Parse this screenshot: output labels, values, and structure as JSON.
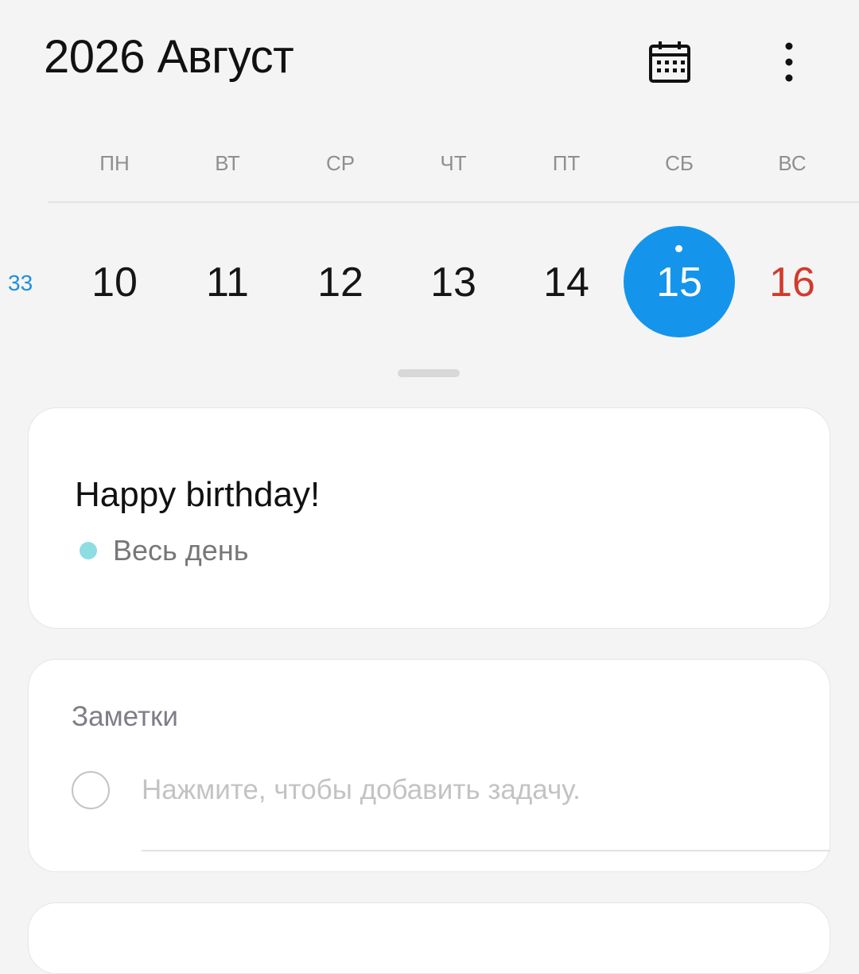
{
  "header": {
    "title": "2026 Август",
    "calendar_icon": "calendar-icon",
    "more_icon": "more-vertical-icon"
  },
  "week": {
    "number": "33",
    "weekdays": [
      "ПН",
      "ВТ",
      "СР",
      "ЧТ",
      "ПТ",
      "СБ",
      "ВС"
    ],
    "days": [
      "10",
      "11",
      "12",
      "13",
      "14",
      "15",
      "16"
    ],
    "selected_day": "15",
    "sunday_day": "16"
  },
  "event": {
    "title": "Happy birthday!",
    "time": "Весь день",
    "color": "#8edde3"
  },
  "notes": {
    "title": "Заметки",
    "placeholder": "Нажмите, чтобы добавить задачу."
  },
  "colors": {
    "accent": "#1495eb",
    "weekend": "#d23a2b",
    "week_number": "#1f8fe0"
  }
}
